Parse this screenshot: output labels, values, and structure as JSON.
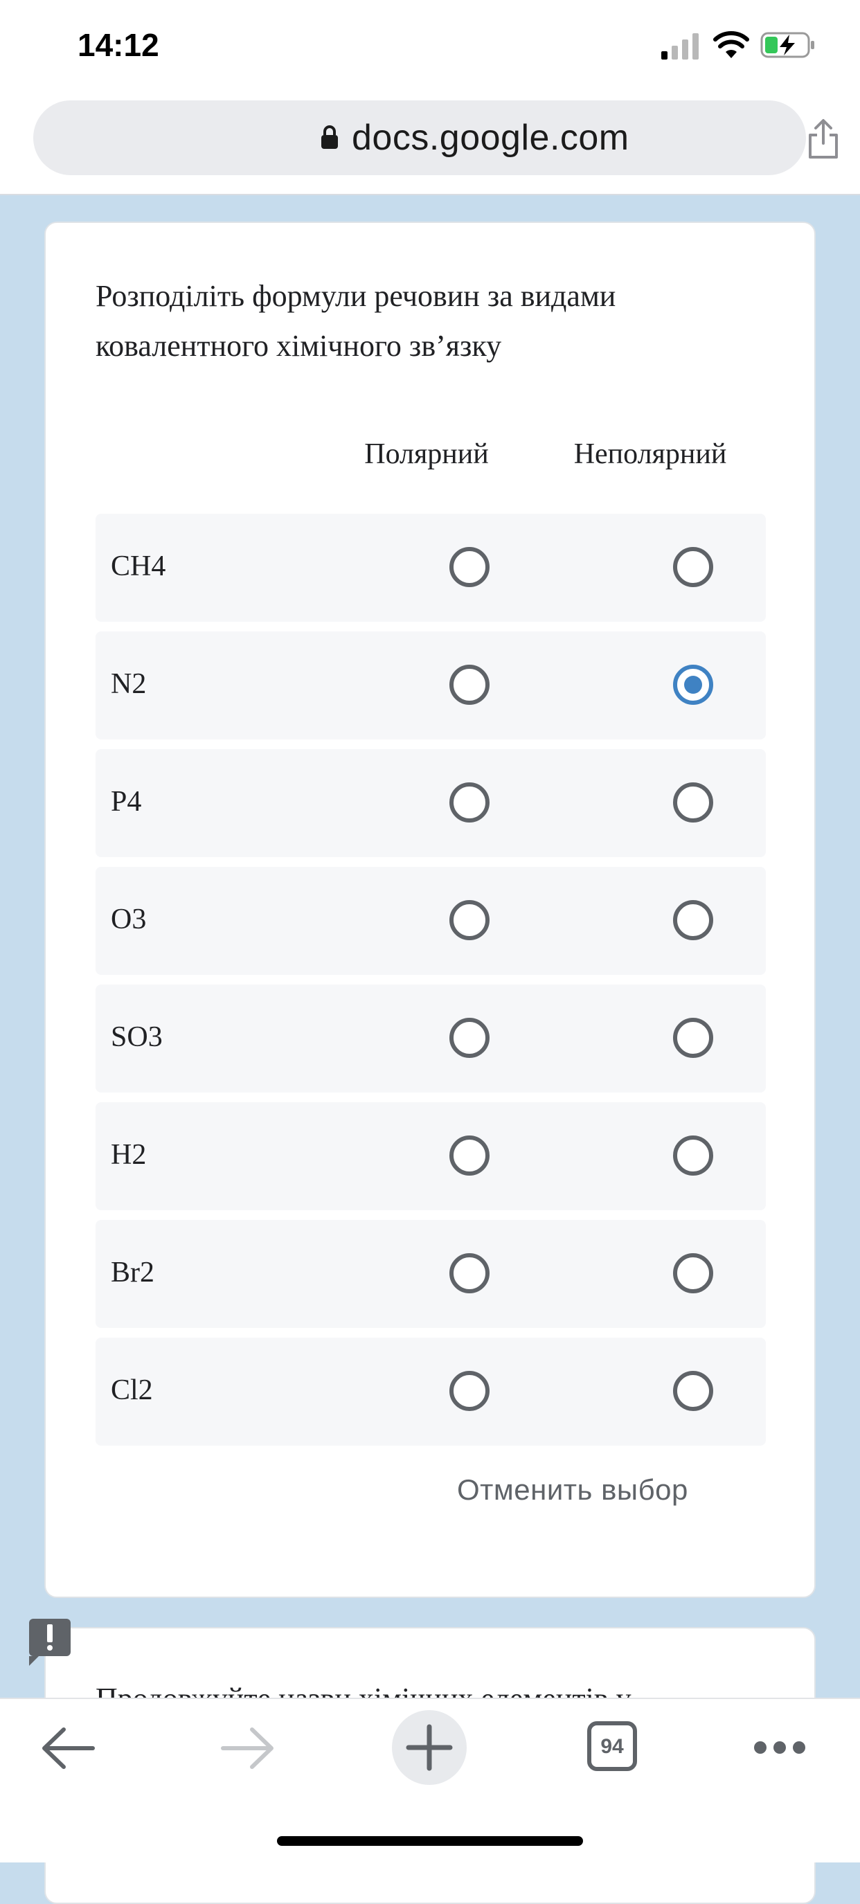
{
  "status_bar": {
    "time": "14:12"
  },
  "browser": {
    "url": "docs.google.com",
    "tab_count": "94"
  },
  "form": {
    "question": "Розподіліть формули речовин за видами ковалентного хімічного зв’язку",
    "columns": [
      "Полярний",
      "Неполярний"
    ],
    "rows": [
      {
        "label": "CH4",
        "selected": null
      },
      {
        "label": "N2",
        "selected": "Неполярний"
      },
      {
        "label": "P4",
        "selected": null
      },
      {
        "label": "O3",
        "selected": null
      },
      {
        "label": "SO3",
        "selected": null
      },
      {
        "label": "H2",
        "selected": null
      },
      {
        "label": "Br2",
        "selected": null
      },
      {
        "label": "Cl2",
        "selected": null
      }
    ],
    "clear_label": "Отменить выбор",
    "next_question_partial": "Продовжуйте назви хімічних елементів у"
  },
  "colors": {
    "accent": "#3f82c3",
    "background": "#c6dced"
  }
}
